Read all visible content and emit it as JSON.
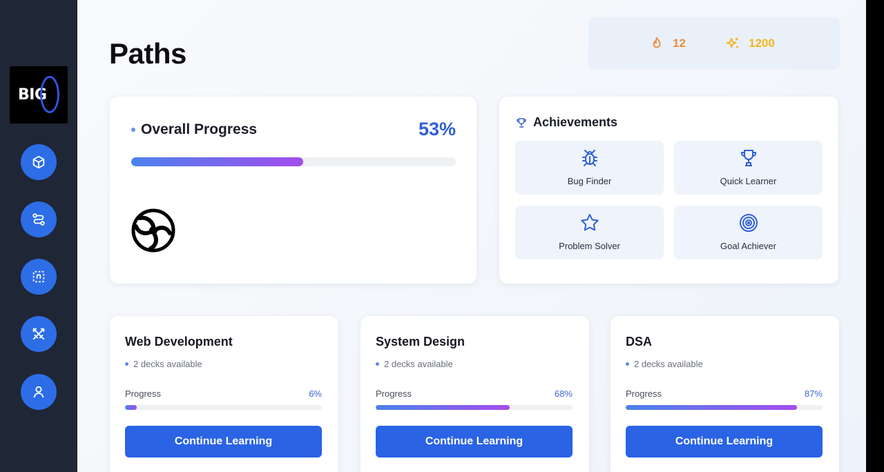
{
  "logo": {
    "text": "BIG"
  },
  "sidebar": {
    "items": [
      {
        "icon": "cube-icon"
      },
      {
        "icon": "route-icon"
      },
      {
        "icon": "dashed-frame-icon"
      },
      {
        "icon": "swords-icon"
      },
      {
        "icon": "user-icon"
      }
    ]
  },
  "page": {
    "title": "Paths"
  },
  "stats": {
    "streak": {
      "icon": "flame-icon",
      "value": "12",
      "color": "#ef8a3c"
    },
    "points": {
      "icon": "sparkles-icon",
      "value": "1200",
      "color": "#f2b620"
    }
  },
  "overall": {
    "title": "Overall Progress",
    "percent_label": "53%",
    "progress": 0.53,
    "emblem": "swirl-emblem-icon"
  },
  "achievements": {
    "title": "Achievements",
    "icon": "trophy-icon",
    "items": [
      {
        "label": "Bug Finder",
        "icon": "bug-icon"
      },
      {
        "label": "Quick Learner",
        "icon": "trophy-icon"
      },
      {
        "label": "Problem Solver",
        "icon": "star-icon"
      },
      {
        "label": "Goal Achiever",
        "icon": "target-icon"
      }
    ]
  },
  "paths": [
    {
      "title": "Web Development",
      "decks": "2 decks available",
      "progress_label": "Progress",
      "percent_label": "6%",
      "progress": 0.06,
      "button": "Continue Learning"
    },
    {
      "title": "System Design",
      "decks": "2 decks available",
      "progress_label": "Progress",
      "percent_label": "68%",
      "progress": 0.68,
      "button": "Continue Learning"
    },
    {
      "title": "DSA",
      "decks": "2 decks available",
      "progress_label": "Progress",
      "percent_label": "87%",
      "progress": 0.87,
      "button": "Continue Learning"
    }
  ],
  "colors": {
    "sidebar_bg": "#1f2635",
    "accent_blue": "#2a63e4",
    "progress_gradient_start": "#4a82ec",
    "progress_gradient_end": "#a44ded"
  }
}
